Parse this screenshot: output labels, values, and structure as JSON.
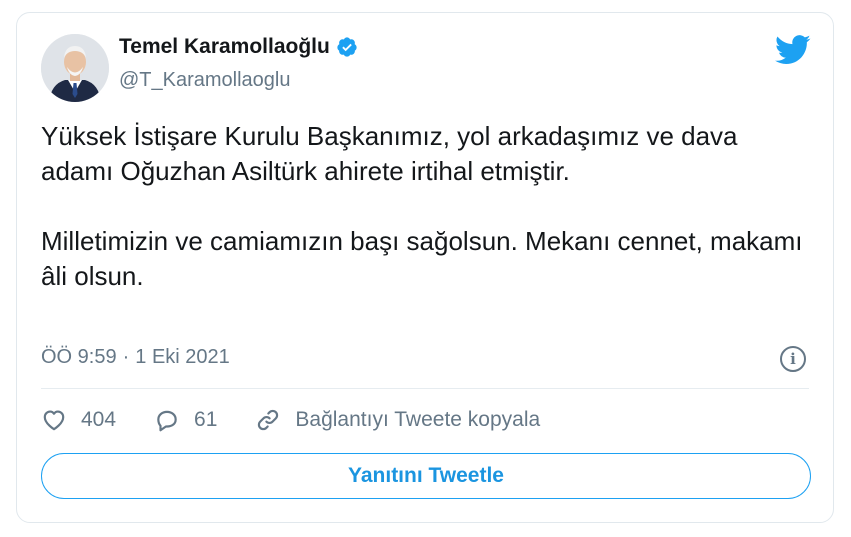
{
  "author": {
    "display_name": "Temel Karamollaoğlu",
    "handle": "@T_Karamollaoglu",
    "verified": true
  },
  "tweet": {
    "paragraph_1": "Yüksek İstişare Kurulu Başkanımız, yol arkadaşımız ve dava adamı Oğuzhan Asiltürk ahirete irtihal etmiştir.",
    "paragraph_2": "Milletimizin ve camiamızın başı sağolsun. Mekanı cennet, makamı âli olsun.",
    "time": "ÖÖ 9:59",
    "separator": "·",
    "date": "1 Eki 2021"
  },
  "actions": {
    "likes": "404",
    "replies": "61",
    "copy_link_label": "Bağlantıyı Tweete kopyala"
  },
  "reply_button_label": "Yanıtını Tweetle",
  "icons": {
    "brand": "twitter-bird-icon",
    "verified": "verified-badge-icon",
    "info": "info-icon",
    "like": "heart-icon",
    "reply": "reply-bubble-icon",
    "link": "link-icon"
  },
  "colors": {
    "brand_blue": "#1da1f2",
    "text_primary": "#14171a",
    "text_secondary": "#657786",
    "border": "#e1e8ed"
  }
}
